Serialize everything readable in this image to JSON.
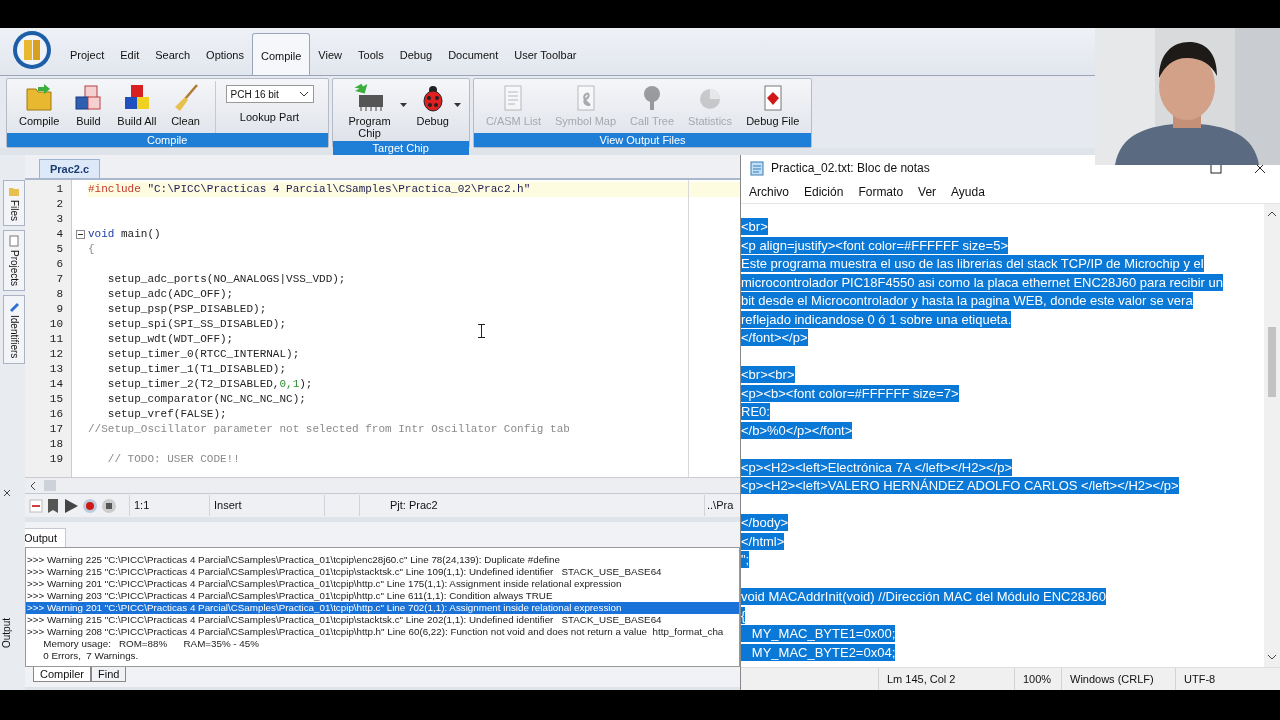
{
  "menu": [
    {
      "label": "Project",
      "selected": false
    },
    {
      "label": "Edit",
      "selected": false
    },
    {
      "label": "Search",
      "selected": false
    },
    {
      "label": "Options",
      "selected": false
    },
    {
      "label": "Compile",
      "selected": true
    },
    {
      "label": "View",
      "selected": false
    },
    {
      "label": "Tools",
      "selected": false
    },
    {
      "label": "Debug",
      "selected": false
    },
    {
      "label": "Document",
      "selected": false
    },
    {
      "label": "User Toolbar",
      "selected": false
    }
  ],
  "ribbon": [
    {
      "label": "Compile",
      "items": [
        {
          "kind": "button",
          "label": "Compile",
          "disabled": false
        },
        {
          "kind": "button",
          "label": "Build",
          "disabled": false
        },
        {
          "kind": "button",
          "label": "Build All",
          "disabled": false
        },
        {
          "kind": "button",
          "label": "Clean",
          "disabled": false
        },
        {
          "kind": "selector",
          "value": "PCH 16 bit",
          "button": "Lookup Part"
        }
      ]
    },
    {
      "label": "Target Chip",
      "items": [
        {
          "kind": "split",
          "label": "Program Chip",
          "disabled": false
        },
        {
          "kind": "split",
          "label": "Debug",
          "disabled": false
        }
      ]
    },
    {
      "label": "View Output Files",
      "items": [
        {
          "kind": "button",
          "label": "C/ASM List",
          "disabled": true
        },
        {
          "kind": "button",
          "label": "Symbol Map",
          "disabled": true
        },
        {
          "kind": "button",
          "label": "Call Tree",
          "disabled": true
        },
        {
          "kind": "button",
          "label": "Statistics",
          "disabled": true
        },
        {
          "kind": "button",
          "label": "Debug File",
          "disabled": false
        }
      ]
    }
  ],
  "side_tabs": [
    "Files",
    "Projects",
    "Identifiers"
  ],
  "editor": {
    "tab": "Prac2.c",
    "lines": [
      {
        "number": "1",
        "current": true,
        "tokens": [
          {
            "text": "#include ",
            "kind": "directive"
          },
          {
            "text": "\"C:\\PICC\\Practicas 4 Parcial\\CSamples\\Practica_02\\Prac2.h\"",
            "kind": "string"
          }
        ]
      },
      {
        "number": "2",
        "current": false
      },
      {
        "number": "3",
        "current": false
      },
      {
        "number": "4",
        "current": false,
        "fold": true,
        "tokens": [
          {
            "text": "void",
            "kind": "keyword"
          },
          {
            "text": " main()",
            "kind": "plain"
          }
        ]
      },
      {
        "number": "5",
        "current": false,
        "tokens": [
          {
            "text": "{",
            "kind": "punct"
          }
        ]
      },
      {
        "number": "6",
        "current": false
      },
      {
        "number": "7",
        "current": false,
        "tokens": [
          {
            "text": "   setup_adc_ports(NO_ANALOGS|VSS_VDD);",
            "kind": "plain"
          }
        ]
      },
      {
        "number": "8",
        "current": false,
        "tokens": [
          {
            "text": "   setup_adc(ADC_OFF);",
            "kind": "plain"
          }
        ]
      },
      {
        "number": "9",
        "current": false,
        "tokens": [
          {
            "text": "   setup_psp(PSP_DISABLED);",
            "kind": "plain"
          }
        ]
      },
      {
        "number": "10",
        "current": false,
        "tokens": [
          {
            "text": "   setup_spi(SPI_SS_DISABLED);",
            "kind": "plain"
          }
        ]
      },
      {
        "number": "11",
        "current": false,
        "tokens": [
          {
            "text": "   setup_wdt(WDT_OFF);",
            "kind": "plain"
          }
        ]
      },
      {
        "number": "12",
        "current": false,
        "tokens": [
          {
            "text": "   setup_timer_0(RTCC_INTERNAL);",
            "kind": "plain"
          }
        ]
      },
      {
        "number": "13",
        "current": false,
        "tokens": [
          {
            "text": "   setup_timer_1(T1_DISABLED);",
            "kind": "plain"
          }
        ]
      },
      {
        "number": "14",
        "current": false,
        "tokens": [
          {
            "text": "   setup_timer_2(T2_DISABLED,",
            "kind": "plain"
          },
          {
            "text": "0,1",
            "kind": "number"
          },
          {
            "text": ");",
            "kind": "plain"
          }
        ]
      },
      {
        "number": "15",
        "current": false,
        "tokens": [
          {
            "text": "   setup_comparator(NC_NC_NC_NC);",
            "kind": "plain"
          }
        ]
      },
      {
        "number": "16",
        "current": false,
        "tokens": [
          {
            "text": "   setup_vref(FALSE);",
            "kind": "plain"
          }
        ]
      },
      {
        "number": "17",
        "current": false,
        "tokens": [
          {
            "text": "//Setup_Oscillator parameter not selected from Intr Oscillator Config tab",
            "kind": "comment"
          }
        ]
      },
      {
        "number": "18",
        "current": false
      },
      {
        "number": "19",
        "current": false,
        "tokens": [
          {
            "text": "   // TODO: USER CODE!!",
            "kind": "comment"
          }
        ]
      }
    ]
  },
  "editor_status": {
    "position": "1:1",
    "mode": "Insert",
    "project": "Pjt: Prac2",
    "path": "..\\Pra"
  },
  "output": {
    "tab": "Output",
    "side_label": "Output",
    "lines": [
      {
        "text": ">>> Warning 225 \"C:\\PICC\\Practicas 4 Parcial\\CSamples\\Practica_01\\tcpip\\enc28j60.c\" Line 78(24,139): Duplicate #define",
        "selected": false
      },
      {
        "text": ">>> Warning 215 \"C:\\PICC\\Practicas 4 Parcial\\CSamples\\Practica_01\\tcpip\\stacktsk.c\" Line 109(1,1): Undefined identifier   STACK_USE_BASE64",
        "selected": false
      },
      {
        "text": ">>> Warning 201 \"C:\\PICC\\Practicas 4 Parcial\\CSamples\\Practica_01\\tcpip\\http.c\" Line 175(1,1): Assignment inside relational expression",
        "selected": false
      },
      {
        "text": ">>> Warning 203 \"C:\\PICC\\Practicas 4 Parcial\\CSamples\\Practica_01\\tcpip\\http.c\" Line 611(1,1): Condition always TRUE",
        "selected": false
      },
      {
        "text": ">>> Warning 201 \"C:\\PICC\\Practicas 4 Parcial\\CSamples\\Practica_01\\tcpip\\http.c\" Line 702(1,1): Assignment inside relational expression",
        "selected": true
      },
      {
        "text": ">>> Warning 215 \"C:\\PICC\\Practicas 4 Parcial\\CSamples\\Practica_01\\tcpip\\stacktsk.c\" Line 202(1,1): Undefined identifier   STACK_USE_BASE64",
        "selected": false
      },
      {
        "text": ">>> Warning 208 \"C:\\PICC\\Practicas 4 Parcial\\CSamples\\Practica_01\\tcpip\\http.h\" Line 60(6,22): Function not void and does not return a value  http_format_cha",
        "selected": false
      },
      {
        "text": "      Memory usage:   ROM=88%      RAM=35% - 45%",
        "selected": false
      },
      {
        "text": "      0 Errors,  7 Warnings.",
        "selected": false
      }
    ],
    "tabs": [
      {
        "label": "Compiler",
        "selected": true
      },
      {
        "label": "Find",
        "selected": false
      }
    ]
  },
  "notepad": {
    "title": "Practica_02.txt: Bloc de notas",
    "menu": [
      "Archivo",
      "Edición",
      "Formato",
      "Ver",
      "Ayuda"
    ],
    "selected": true,
    "blocks": [
      [
        "<br>",
        "<p align=justify><font color=#FFFFFF size=5>",
        "Este programa muestra el uso de las librerias del stack TCP/IP de Microchip y el",
        "microcontrolador PIC18F4550 asi como la placa ethernet ENC28J60 para recibir un",
        "bit desde el Microcontrolador y hasta la pagina WEB, donde este valor se vera",
        "reflejado indicandose 0 ó 1 sobre una etiqueta.",
        "</font></p>"
      ],
      [
        "<br><br>",
        "<p><b><font color=#FFFFFF size=7>",
        "RE0:",
        "</b>%0</p></font>"
      ],
      [
        "<p><H2><left>Electrónica 7A </left></H2></p>",
        "<p><H2><left>VALERO HERNÁNDEZ ADOLFO CARLOS </left></H2></p>"
      ],
      [
        "</body>",
        "</html>",
        "\";"
      ],
      [
        "void MACAddrInit(void) //Dirección MAC del Módulo ENC28J60",
        "{",
        "   MY_MAC_BYTE1=0x00;",
        "   MY_MAC_BYTE2=0x04;"
      ]
    ],
    "status": [
      "Lm 145, Col 2",
      "100%",
      "Windows (CRLF)",
      "UTF-8"
    ]
  },
  "webcam": {
    "kind": "picture"
  }
}
